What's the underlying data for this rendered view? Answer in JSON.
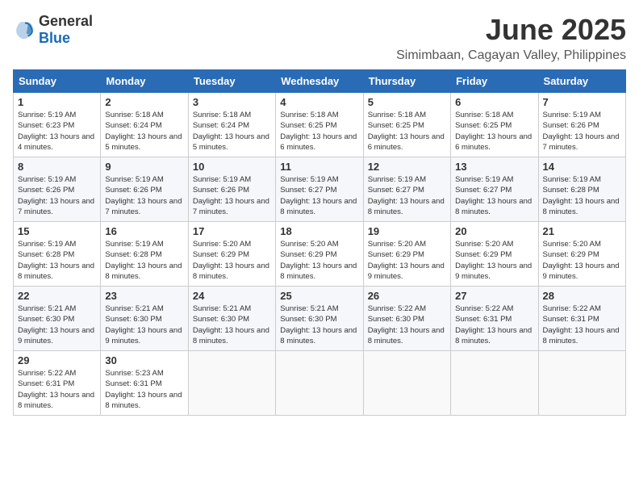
{
  "logo": {
    "general": "General",
    "blue": "Blue"
  },
  "title": {
    "month_year": "June 2025",
    "location": "Simimbaan, Cagayan Valley, Philippines"
  },
  "calendar": {
    "headers": [
      "Sunday",
      "Monday",
      "Tuesday",
      "Wednesday",
      "Thursday",
      "Friday",
      "Saturday"
    ],
    "weeks": [
      [
        {
          "day": "",
          "sunrise": "",
          "sunset": "",
          "daylight": ""
        },
        {
          "day": "2",
          "sunrise": "Sunrise: 5:18 AM",
          "sunset": "Sunset: 6:24 PM",
          "daylight": "Daylight: 13 hours and 5 minutes."
        },
        {
          "day": "3",
          "sunrise": "Sunrise: 5:18 AM",
          "sunset": "Sunset: 6:24 PM",
          "daylight": "Daylight: 13 hours and 5 minutes."
        },
        {
          "day": "4",
          "sunrise": "Sunrise: 5:18 AM",
          "sunset": "Sunset: 6:25 PM",
          "daylight": "Daylight: 13 hours and 6 minutes."
        },
        {
          "day": "5",
          "sunrise": "Sunrise: 5:18 AM",
          "sunset": "Sunset: 6:25 PM",
          "daylight": "Daylight: 13 hours and 6 minutes."
        },
        {
          "day": "6",
          "sunrise": "Sunrise: 5:18 AM",
          "sunset": "Sunset: 6:25 PM",
          "daylight": "Daylight: 13 hours and 6 minutes."
        },
        {
          "day": "7",
          "sunrise": "Sunrise: 5:19 AM",
          "sunset": "Sunset: 6:26 PM",
          "daylight": "Daylight: 13 hours and 7 minutes."
        }
      ],
      [
        {
          "day": "1",
          "sunrise": "Sunrise: 5:19 AM",
          "sunset": "Sunset: 6:23 PM",
          "daylight": "Daylight: 13 hours and 4 minutes."
        },
        {
          "day": "9",
          "sunrise": "Sunrise: 5:19 AM",
          "sunset": "Sunset: 6:26 PM",
          "daylight": "Daylight: 13 hours and 7 minutes."
        },
        {
          "day": "10",
          "sunrise": "Sunrise: 5:19 AM",
          "sunset": "Sunset: 6:26 PM",
          "daylight": "Daylight: 13 hours and 7 minutes."
        },
        {
          "day": "11",
          "sunrise": "Sunrise: 5:19 AM",
          "sunset": "Sunset: 6:27 PM",
          "daylight": "Daylight: 13 hours and 8 minutes."
        },
        {
          "day": "12",
          "sunrise": "Sunrise: 5:19 AM",
          "sunset": "Sunset: 6:27 PM",
          "daylight": "Daylight: 13 hours and 8 minutes."
        },
        {
          "day": "13",
          "sunrise": "Sunrise: 5:19 AM",
          "sunset": "Sunset: 6:27 PM",
          "daylight": "Daylight: 13 hours and 8 minutes."
        },
        {
          "day": "14",
          "sunrise": "Sunrise: 5:19 AM",
          "sunset": "Sunset: 6:28 PM",
          "daylight": "Daylight: 13 hours and 8 minutes."
        }
      ],
      [
        {
          "day": "8",
          "sunrise": "Sunrise: 5:19 AM",
          "sunset": "Sunset: 6:26 PM",
          "daylight": "Daylight: 13 hours and 7 minutes."
        },
        {
          "day": "16",
          "sunrise": "Sunrise: 5:19 AM",
          "sunset": "Sunset: 6:28 PM",
          "daylight": "Daylight: 13 hours and 8 minutes."
        },
        {
          "day": "17",
          "sunrise": "Sunrise: 5:20 AM",
          "sunset": "Sunset: 6:29 PM",
          "daylight": "Daylight: 13 hours and 8 minutes."
        },
        {
          "day": "18",
          "sunrise": "Sunrise: 5:20 AM",
          "sunset": "Sunset: 6:29 PM",
          "daylight": "Daylight: 13 hours and 8 minutes."
        },
        {
          "day": "19",
          "sunrise": "Sunrise: 5:20 AM",
          "sunset": "Sunset: 6:29 PM",
          "daylight": "Daylight: 13 hours and 9 minutes."
        },
        {
          "day": "20",
          "sunrise": "Sunrise: 5:20 AM",
          "sunset": "Sunset: 6:29 PM",
          "daylight": "Daylight: 13 hours and 9 minutes."
        },
        {
          "day": "21",
          "sunrise": "Sunrise: 5:20 AM",
          "sunset": "Sunset: 6:29 PM",
          "daylight": "Daylight: 13 hours and 9 minutes."
        }
      ],
      [
        {
          "day": "15",
          "sunrise": "Sunrise: 5:19 AM",
          "sunset": "Sunset: 6:28 PM",
          "daylight": "Daylight: 13 hours and 8 minutes."
        },
        {
          "day": "23",
          "sunrise": "Sunrise: 5:21 AM",
          "sunset": "Sunset: 6:30 PM",
          "daylight": "Daylight: 13 hours and 9 minutes."
        },
        {
          "day": "24",
          "sunrise": "Sunrise: 5:21 AM",
          "sunset": "Sunset: 6:30 PM",
          "daylight": "Daylight: 13 hours and 8 minutes."
        },
        {
          "day": "25",
          "sunrise": "Sunrise: 5:21 AM",
          "sunset": "Sunset: 6:30 PM",
          "daylight": "Daylight: 13 hours and 8 minutes."
        },
        {
          "day": "26",
          "sunrise": "Sunrise: 5:22 AM",
          "sunset": "Sunset: 6:30 PM",
          "daylight": "Daylight: 13 hours and 8 minutes."
        },
        {
          "day": "27",
          "sunrise": "Sunrise: 5:22 AM",
          "sunset": "Sunset: 6:31 PM",
          "daylight": "Daylight: 13 hours and 8 minutes."
        },
        {
          "day": "28",
          "sunrise": "Sunrise: 5:22 AM",
          "sunset": "Sunset: 6:31 PM",
          "daylight": "Daylight: 13 hours and 8 minutes."
        }
      ],
      [
        {
          "day": "22",
          "sunrise": "Sunrise: 5:21 AM",
          "sunset": "Sunset: 6:30 PM",
          "daylight": "Daylight: 13 hours and 9 minutes."
        },
        {
          "day": "30",
          "sunrise": "Sunrise: 5:23 AM",
          "sunset": "Sunset: 6:31 PM",
          "daylight": "Daylight: 13 hours and 8 minutes."
        },
        {
          "day": "",
          "sunrise": "",
          "sunset": "",
          "daylight": ""
        },
        {
          "day": "",
          "sunrise": "",
          "sunset": "",
          "daylight": ""
        },
        {
          "day": "",
          "sunrise": "",
          "sunset": "",
          "daylight": ""
        },
        {
          "day": "",
          "sunrise": "",
          "sunset": "",
          "daylight": ""
        },
        {
          "day": "",
          "sunrise": "",
          "sunset": "",
          "daylight": ""
        }
      ]
    ],
    "week5_row1": {
      "day": "29",
      "sunrise": "Sunrise: 5:22 AM",
      "sunset": "Sunset: 6:31 PM",
      "daylight": "Daylight: 13 hours and 8 minutes."
    }
  }
}
